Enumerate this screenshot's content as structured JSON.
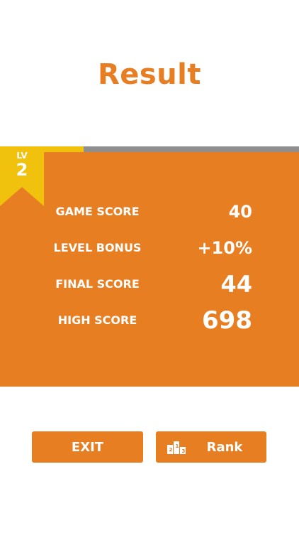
{
  "title": "Result",
  "level": {
    "label": "LV",
    "value": "2",
    "progress_fraction": 0.28
  },
  "scores": [
    {
      "label": "GAME SCORE",
      "value": "40"
    },
    {
      "label": "LEVEL BONUS",
      "value": "+10%"
    },
    {
      "label": "FINAL SCORE",
      "value": "44"
    },
    {
      "label": "HIGH SCORE",
      "value": "698"
    }
  ],
  "buttons": {
    "exit_label": "EXIT",
    "rank_label": "Rank"
  },
  "colors": {
    "accent": "#e87e22",
    "level_yellow": "#f0c20d",
    "track_gray": "#8f8f8f"
  },
  "icons": {
    "rank": "podium-icon"
  }
}
